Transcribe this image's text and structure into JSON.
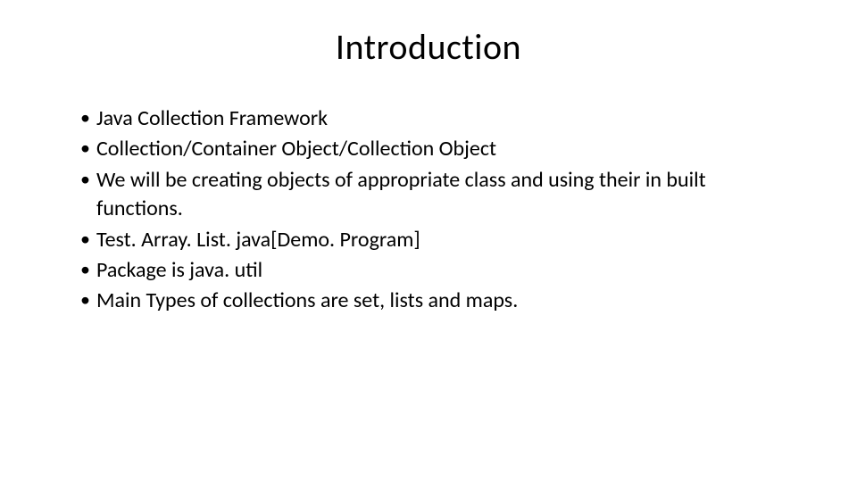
{
  "slide": {
    "title": "Introduction",
    "bullets": [
      "Java Collection Framework",
      "Collection/Container Object/Collection Object",
      "We will be creating objects of appropriate class and using their in built functions.",
      "Test. Array. List. java[Demo. Program]",
      "Package is java. util",
      "Main Types of collections are set, lists and maps."
    ]
  }
}
